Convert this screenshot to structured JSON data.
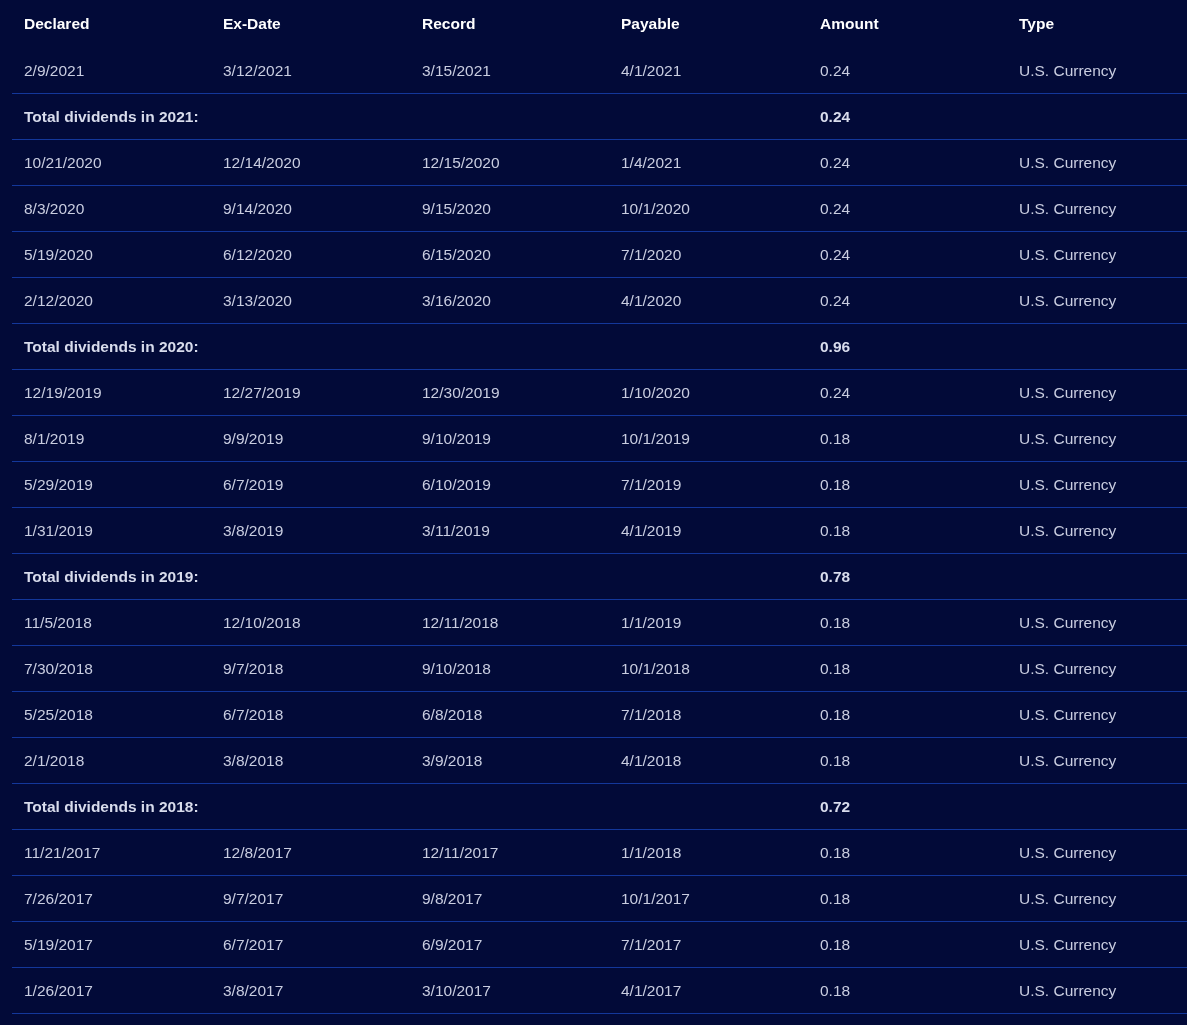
{
  "table": {
    "columns": [
      "Declared",
      "Ex-Date",
      "Record",
      "Payable",
      "Amount",
      "Type"
    ],
    "rows": [
      {
        "kind": "payment",
        "cells": [
          "2/9/2021",
          "3/12/2021",
          "3/15/2021",
          "4/1/2021",
          "0.24",
          "U.S. Currency"
        ]
      },
      {
        "kind": "total",
        "label": "Total dividends in 2021:",
        "amount": "0.24"
      },
      {
        "kind": "payment",
        "cells": [
          "10/21/2020",
          "12/14/2020",
          "12/15/2020",
          "1/4/2021",
          "0.24",
          "U.S. Currency"
        ]
      },
      {
        "kind": "payment",
        "cells": [
          "8/3/2020",
          "9/14/2020",
          "9/15/2020",
          "10/1/2020",
          "0.24",
          "U.S. Currency"
        ]
      },
      {
        "kind": "payment",
        "cells": [
          "5/19/2020",
          "6/12/2020",
          "6/15/2020",
          "7/1/2020",
          "0.24",
          "U.S. Currency"
        ]
      },
      {
        "kind": "payment",
        "cells": [
          "2/12/2020",
          "3/13/2020",
          "3/16/2020",
          "4/1/2020",
          "0.24",
          "U.S. Currency"
        ]
      },
      {
        "kind": "total",
        "label": "Total dividends in 2020:",
        "amount": "0.96"
      },
      {
        "kind": "payment",
        "cells": [
          "12/19/2019",
          "12/27/2019",
          "12/30/2019",
          "1/10/2020",
          "0.24",
          "U.S. Currency"
        ]
      },
      {
        "kind": "payment",
        "cells": [
          "8/1/2019",
          "9/9/2019",
          "9/10/2019",
          "10/1/2019",
          "0.18",
          "U.S. Currency"
        ]
      },
      {
        "kind": "payment",
        "cells": [
          "5/29/2019",
          "6/7/2019",
          "6/10/2019",
          "7/1/2019",
          "0.18",
          "U.S. Currency"
        ]
      },
      {
        "kind": "payment",
        "cells": [
          "1/31/2019",
          "3/8/2019",
          "3/11/2019",
          "4/1/2019",
          "0.18",
          "U.S. Currency"
        ]
      },
      {
        "kind": "total",
        "label": "Total dividends in 2019:",
        "amount": "0.78"
      },
      {
        "kind": "payment",
        "cells": [
          "11/5/2018",
          "12/10/2018",
          "12/11/2018",
          "1/1/2019",
          "0.18",
          "U.S. Currency"
        ]
      },
      {
        "kind": "payment",
        "cells": [
          "7/30/2018",
          "9/7/2018",
          "9/10/2018",
          "10/1/2018",
          "0.18",
          "U.S. Currency"
        ]
      },
      {
        "kind": "payment",
        "cells": [
          "5/25/2018",
          "6/7/2018",
          "6/8/2018",
          "7/1/2018",
          "0.18",
          "U.S. Currency"
        ]
      },
      {
        "kind": "payment",
        "cells": [
          "2/1/2018",
          "3/8/2018",
          "3/9/2018",
          "4/1/2018",
          "0.18",
          "U.S. Currency"
        ]
      },
      {
        "kind": "total",
        "label": "Total dividends in 2018:",
        "amount": "0.72"
      },
      {
        "kind": "payment",
        "cells": [
          "11/21/2017",
          "12/8/2017",
          "12/11/2017",
          "1/1/2018",
          "0.18",
          "U.S. Currency"
        ]
      },
      {
        "kind": "payment",
        "cells": [
          "7/26/2017",
          "9/7/2017",
          "9/8/2017",
          "10/1/2017",
          "0.18",
          "U.S. Currency"
        ]
      },
      {
        "kind": "payment",
        "cells": [
          "5/19/2017",
          "6/7/2017",
          "6/9/2017",
          "7/1/2017",
          "0.18",
          "U.S. Currency"
        ]
      },
      {
        "kind": "payment",
        "cells": [
          "1/26/2017",
          "3/8/2017",
          "3/10/2017",
          "4/1/2017",
          "0.18",
          "U.S. Currency"
        ]
      }
    ]
  }
}
